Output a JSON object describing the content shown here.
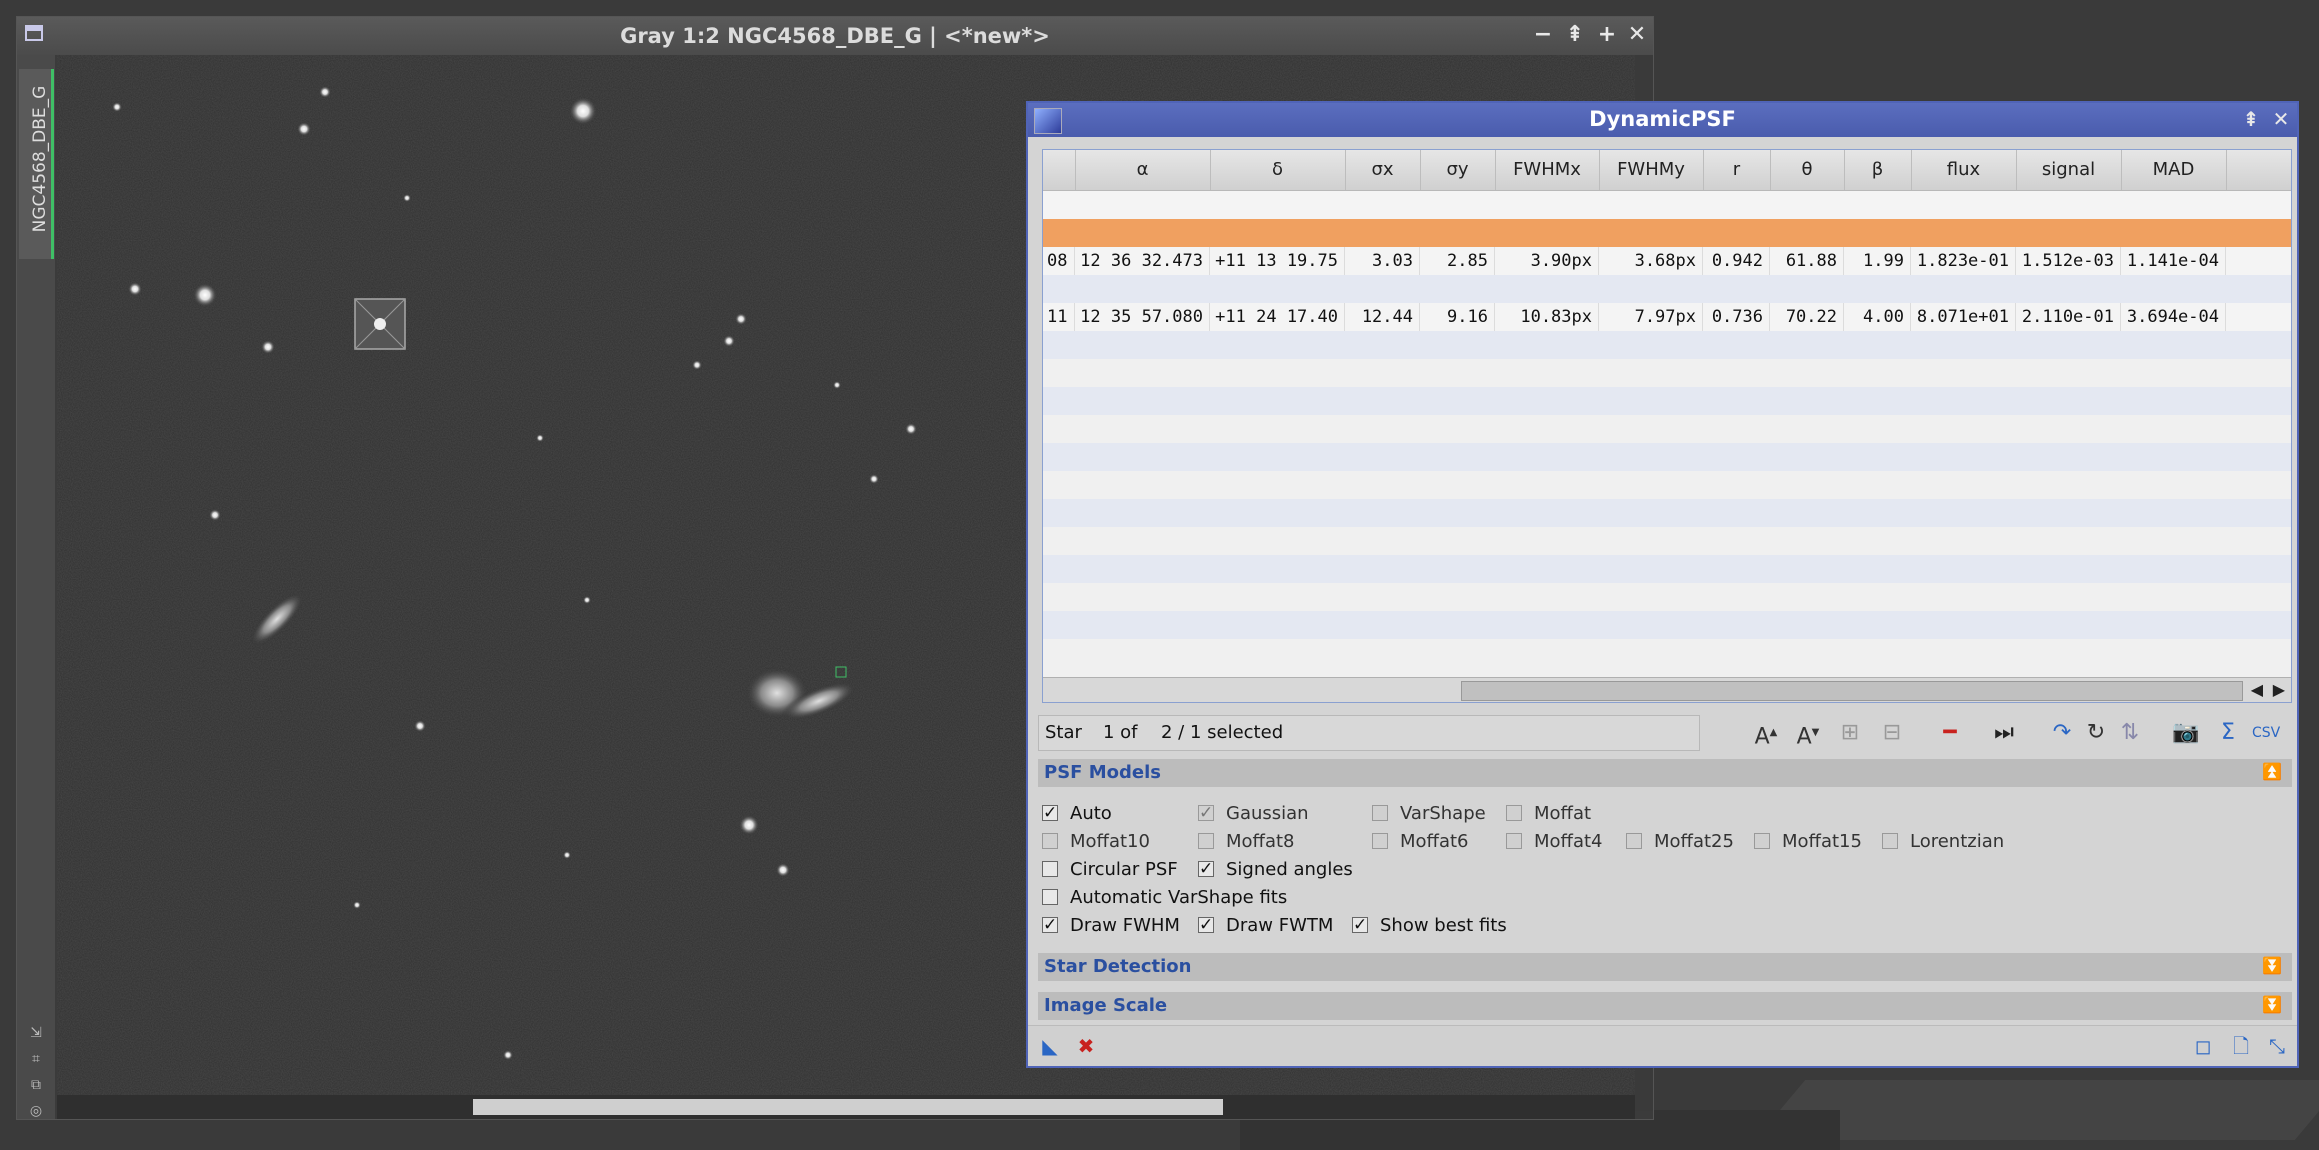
{
  "image_window": {
    "title": "Gray 1:2 NGC4568_DBE_G | <*new*>",
    "side_tab_label": "NGC4568_DBE_G",
    "buttons": {
      "minimize": "−",
      "shade": "⇞",
      "maximize": "+",
      "close": "✕"
    }
  },
  "psf_panel": {
    "title": "DynamicPSF",
    "columns": [
      "",
      "α",
      "δ",
      "σx",
      "σy",
      "FWHMx",
      "FWHMy",
      "r",
      "θ",
      "β",
      "flux",
      "signal",
      "MAD"
    ],
    "rows": [
      {
        "id": "08",
        "alpha": "12 36 32.473",
        "delta": "+11 13 19.75",
        "sx": "3.03",
        "sy": "2.85",
        "fwhmx": "3.90px",
        "fwhmy": "3.68px",
        "r": "0.942",
        "theta": "61.88",
        "beta": "1.99",
        "flux": "1.823e-01",
        "signal": "1.512e-03",
        "mad": "1.141e-04"
      },
      {
        "id": "11",
        "alpha": "12 35 57.080",
        "delta": "+11 24 17.40",
        "sx": "12.44",
        "sy": "9.16",
        "fwhmx": "10.83px",
        "fwhmy": "7.97px",
        "r": "0.736",
        "theta": "70.22",
        "beta": "4.00",
        "flux": "8.071e+01",
        "signal": "2.110e-01",
        "mad": "3.694e-04"
      }
    ],
    "status": {
      "label": "Star",
      "index": "1 of",
      "selected": "2 / 1 selected"
    },
    "sections": {
      "psf_models": "PSF Models",
      "star_detection": "Star Detection",
      "image_scale": "Image Scale"
    },
    "models": {
      "auto": "Auto",
      "gaussian": "Gaussian",
      "varshape": "VarShape",
      "moffat": "Moffat",
      "moffat10": "Moffat10",
      "moffat8": "Moffat8",
      "moffat6": "Moffat6",
      "moffat4": "Moffat4",
      "moffat25": "Moffat25",
      "moffat15": "Moffat15",
      "lorentzian": "Lorentzian"
    },
    "options": {
      "circular_psf": "Circular PSF",
      "signed_angles": "Signed angles",
      "auto_varshape": "Automatic VarShape fits",
      "draw_fwhm": "Draw FWHM",
      "draw_fwtm": "Draw FWTM",
      "show_best_fits": "Show best fits"
    },
    "colors": {
      "selected_row": "#f0a060",
      "title_bar": "#4f62b3",
      "accent": "#2a4fa0"
    }
  }
}
